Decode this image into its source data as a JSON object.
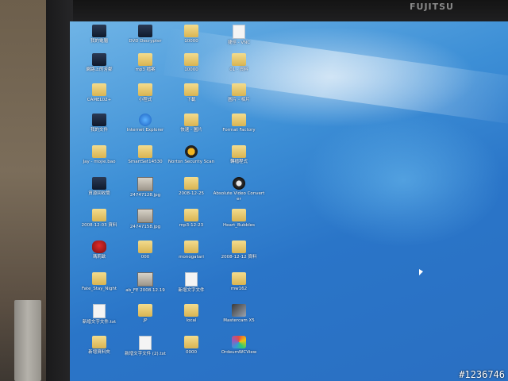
{
  "monitor": {
    "brand": "FUJITSU"
  },
  "watermark": "#1236746",
  "desktop_icons": [
    {
      "label": "我的電腦",
      "icon": "computer-icon",
      "col": 0,
      "row": 0
    },
    {
      "label": "DVD Decrypter",
      "icon": "dvd-icon",
      "col": 1,
      "row": 0
    },
    {
      "label": "10000",
      "icon": "folder-icon",
      "col": 2,
      "row": 0
    },
    {
      "label": "捷徑 - VNC",
      "icon": "document-icon",
      "col": 3,
      "row": 0
    },
    {
      "label": "網路上的芳鄰",
      "icon": "network-icon",
      "col": 0,
      "row": 1
    },
    {
      "label": "mp3 檔案",
      "icon": "folder-icon",
      "col": 1,
      "row": 1
    },
    {
      "label": "10000",
      "icon": "folder-icon",
      "col": 2,
      "row": 1
    },
    {
      "label": "01 - 資料",
      "icon": "folder-icon",
      "col": 3,
      "row": 1
    },
    {
      "label": "CAMEL02+",
      "icon": "folder-icon",
      "col": 0,
      "row": 2
    },
    {
      "label": "小程式",
      "icon": "folder-icon",
      "col": 1,
      "row": 2
    },
    {
      "label": "下載",
      "icon": "folder-icon",
      "col": 2,
      "row": 2
    },
    {
      "label": "圖片 - 相片",
      "icon": "folder-icon",
      "col": 3,
      "row": 2
    },
    {
      "label": "我的文件",
      "icon": "my-documents-icon",
      "col": 0,
      "row": 3
    },
    {
      "label": "Internet Explorer",
      "icon": "internet-explorer-icon",
      "col": 1,
      "row": 3
    },
    {
      "label": "快速 - 圖片",
      "icon": "folder-icon",
      "col": 2,
      "row": 3
    },
    {
      "label": "Format Factory",
      "icon": "folder-icon",
      "col": 3,
      "row": 3
    },
    {
      "label": "Jay - mojie.bao",
      "icon": "folder-icon",
      "col": 0,
      "row": 4
    },
    {
      "label": "SmartSet14530",
      "icon": "folder-icon",
      "col": 1,
      "row": 4
    },
    {
      "label": "Norton Security Scan",
      "icon": "norton-icon",
      "col": 2,
      "row": 4
    },
    {
      "label": "轉檔程式",
      "icon": "folder-icon",
      "col": 3,
      "row": 4
    },
    {
      "label": "資源回收筒",
      "icon": "recycle-bin-icon",
      "col": 0,
      "row": 5
    },
    {
      "label": "24747128.jpg",
      "icon": "image-file-icon",
      "col": 1,
      "row": 5
    },
    {
      "label": "2008-12-25",
      "icon": "folder-icon",
      "col": 2,
      "row": 5
    },
    {
      "label": "Absolute Video Converter",
      "icon": "video-reel-icon",
      "col": 3,
      "row": 5
    },
    {
      "label": "2008-12-03 資料",
      "icon": "folder-icon",
      "col": 0,
      "row": 6
    },
    {
      "label": "24747158.jpg",
      "icon": "image-file-icon",
      "col": 1,
      "row": 6
    },
    {
      "label": "mp3-12-23",
      "icon": "folder-icon",
      "col": 2,
      "row": 6
    },
    {
      "label": "Heart_Bubbles",
      "icon": "folder-icon",
      "col": 3,
      "row": 6
    },
    {
      "label": "瑪莉歐",
      "icon": "mario-icon",
      "col": 0,
      "row": 7
    },
    {
      "label": "000",
      "icon": "folder-icon",
      "col": 1,
      "row": 7
    },
    {
      "label": "monogatari",
      "icon": "folder-icon",
      "col": 2,
      "row": 7
    },
    {
      "label": "2008-12-12 資料",
      "icon": "folder-icon",
      "col": 3,
      "row": 7
    },
    {
      "label": "Fate_Stay_Night",
      "icon": "folder-icon",
      "col": 0,
      "row": 8
    },
    {
      "label": "ab_FE 2008.12.19",
      "icon": "image-file-icon",
      "col": 1,
      "row": 8
    },
    {
      "label": "新增文字文件",
      "icon": "document-icon",
      "col": 2,
      "row": 8
    },
    {
      "label": "mw162",
      "icon": "folder-icon",
      "col": 3,
      "row": 8
    },
    {
      "label": "新增文字文件.txt",
      "icon": "document-icon",
      "col": 0,
      "row": 9
    },
    {
      "label": "JP",
      "icon": "folder-icon",
      "col": 1,
      "row": 9
    },
    {
      "label": "local",
      "icon": "folder-icon",
      "col": 2,
      "row": 9
    },
    {
      "label": "Mastercam X5",
      "icon": "mastercam-icon",
      "col": 3,
      "row": 9
    },
    {
      "label": "新增資料夾",
      "icon": "folder-icon",
      "col": 0,
      "row": 10
    },
    {
      "label": "新增文字文件 (2).txt",
      "icon": "document-icon",
      "col": 1,
      "row": 10
    },
    {
      "label": "0000",
      "icon": "folder-icon",
      "col": 2,
      "row": 10
    },
    {
      "label": "OrdeumWCView",
      "icon": "color-app-icon",
      "col": 3,
      "row": 10
    }
  ]
}
